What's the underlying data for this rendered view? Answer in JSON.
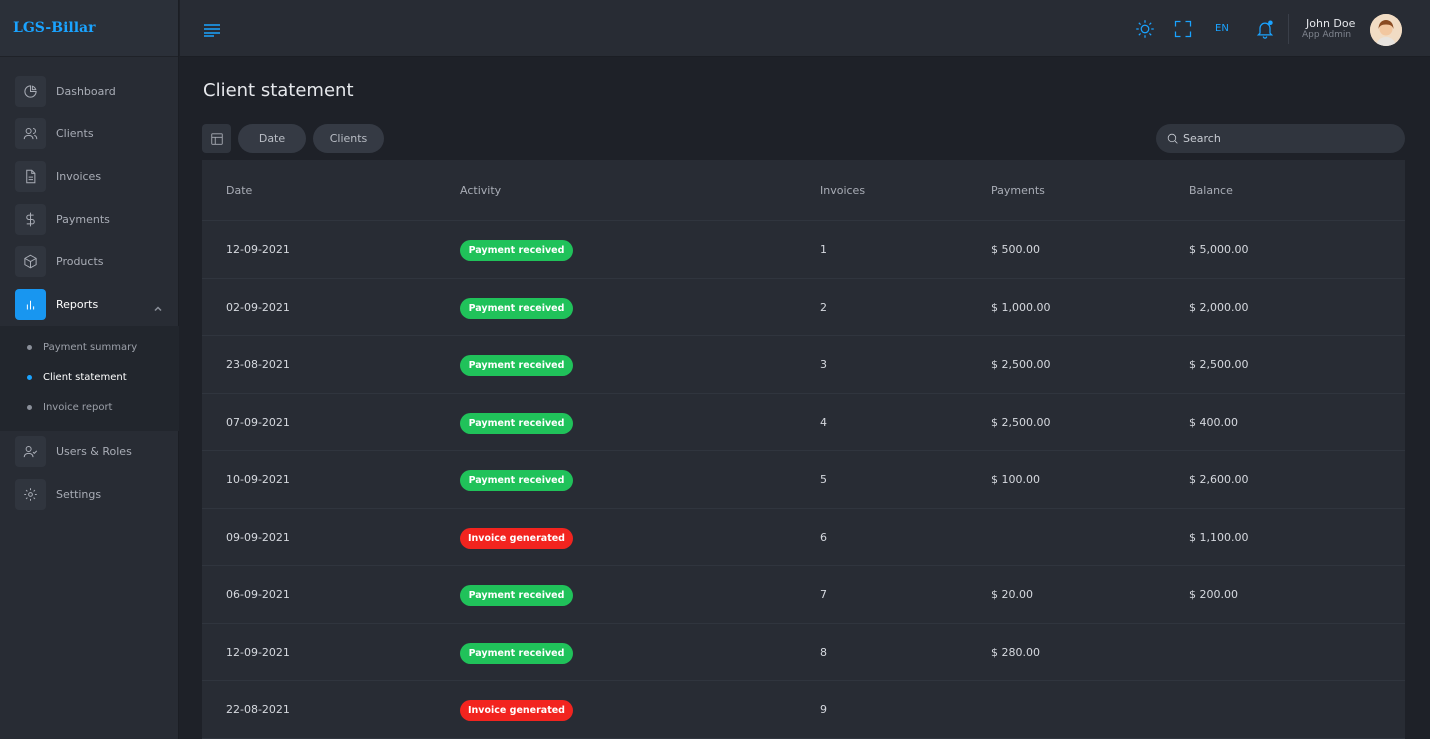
{
  "app": {
    "brand": "LGS-Billar"
  },
  "sidebar": {
    "items": [
      {
        "label": "Dashboard",
        "icon": "pie-chart-icon"
      },
      {
        "label": "Clients",
        "icon": "users-icon"
      },
      {
        "label": "Invoices",
        "icon": "file-icon"
      },
      {
        "label": "Payments",
        "icon": "dollar-icon"
      },
      {
        "label": "Products",
        "icon": "box-icon"
      },
      {
        "label": "Reports",
        "icon": "bar-chart-icon",
        "active": true
      }
    ],
    "reports_sub": [
      {
        "label": "Payment summary"
      },
      {
        "label": "Client statement",
        "active": true
      },
      {
        "label": "Invoice report"
      }
    ],
    "bottom_items": [
      {
        "label": "Users & Roles",
        "icon": "user-check-icon"
      },
      {
        "label": "Settings",
        "icon": "gear-icon"
      }
    ]
  },
  "header": {
    "lang": "EN",
    "user_name": "John Doe",
    "user_role": "App Admin"
  },
  "main": {
    "title": "Client statement",
    "filters": {
      "date": "Date",
      "clients": "Clients"
    },
    "search_placeholder": "Search",
    "columns": [
      "Date",
      "Activity",
      "Invoices",
      "Payments",
      "Balance"
    ],
    "rows": [
      {
        "date": "12-09-2021",
        "activity": "Payment received",
        "status": "green",
        "invoices": "1",
        "payments": "$ 500.00",
        "balance": "$ 5,000.00"
      },
      {
        "date": "02-09-2021",
        "activity": "Payment received",
        "status": "green",
        "invoices": "2",
        "payments": "$ 1,000.00",
        "balance": "$ 2,000.00"
      },
      {
        "date": "23-08-2021",
        "activity": "Payment received",
        "status": "green",
        "invoices": "3",
        "payments": "$ 2,500.00",
        "balance": "$ 2,500.00"
      },
      {
        "date": "07-09-2021",
        "activity": "Payment received",
        "status": "green",
        "invoices": "4",
        "payments": "$ 2,500.00",
        "balance": "$ 400.00"
      },
      {
        "date": "10-09-2021",
        "activity": "Payment received",
        "status": "green",
        "invoices": "5",
        "payments": "$ 100.00",
        "balance": "$ 2,600.00"
      },
      {
        "date": "09-09-2021",
        "activity": "Invoice generated",
        "status": "red",
        "invoices": "6",
        "payments": "",
        "balance": "$ 1,100.00"
      },
      {
        "date": "06-09-2021",
        "activity": "Payment received",
        "status": "green",
        "invoices": "7",
        "payments": "$ 20.00",
        "balance": "$ 200.00"
      },
      {
        "date": "12-09-2021",
        "activity": "Payment received",
        "status": "green",
        "invoices": "8",
        "payments": "$ 280.00",
        "balance": ""
      },
      {
        "date": "22-08-2021",
        "activity": "Invoice generated",
        "status": "red",
        "invoices": "9",
        "payments": "",
        "balance": ""
      }
    ]
  },
  "colors": {
    "accent": "#1aa3ff",
    "success": "#20c25a",
    "danger": "#f2241f"
  }
}
